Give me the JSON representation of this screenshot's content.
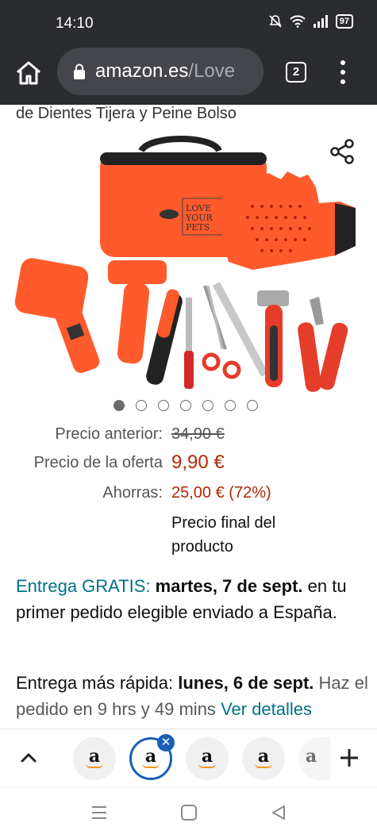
{
  "status_bar": {
    "time": "14:10",
    "battery": "97"
  },
  "browser": {
    "url_domain": "amazon.es",
    "url_path": "/Love",
    "tab_count": "2"
  },
  "product": {
    "title_tail": "de Dientes Tijera y Peine Bolso",
    "brand_on_bag": "LOVE YOUR PETS",
    "carousel": {
      "total": 7,
      "active": 1
    }
  },
  "pricing": {
    "was_label": "Precio anterior:",
    "was_value": "34,90 €",
    "deal_label": "Precio de la oferta",
    "deal_value": "9,90 €",
    "save_label": "Ahorras:",
    "save_value": "25,00 € (72%)",
    "final_note": "Precio final del producto"
  },
  "delivery": {
    "free_label": "Entrega GRATIS:",
    "free_date": "martes, 7 de sept.",
    "free_note": "en tu primer pedido elegible enviado a España.",
    "fast_label": "Entrega más rápida:",
    "fast_date": "lunes, 6 de sept.",
    "order_within": "Haz el pedido en 9 hrs y 49 mins",
    "details_link": "Ver detalles"
  },
  "tab_strip": {
    "tab_icon_letter": "a"
  },
  "colors": {
    "chrome_bg": "#2b2c30",
    "url_bg": "#45464b",
    "price_red": "#b12704",
    "link_teal": "#007185",
    "product_orange": "#ff5a2c",
    "active_tab_blue": "#1a5fb4"
  }
}
